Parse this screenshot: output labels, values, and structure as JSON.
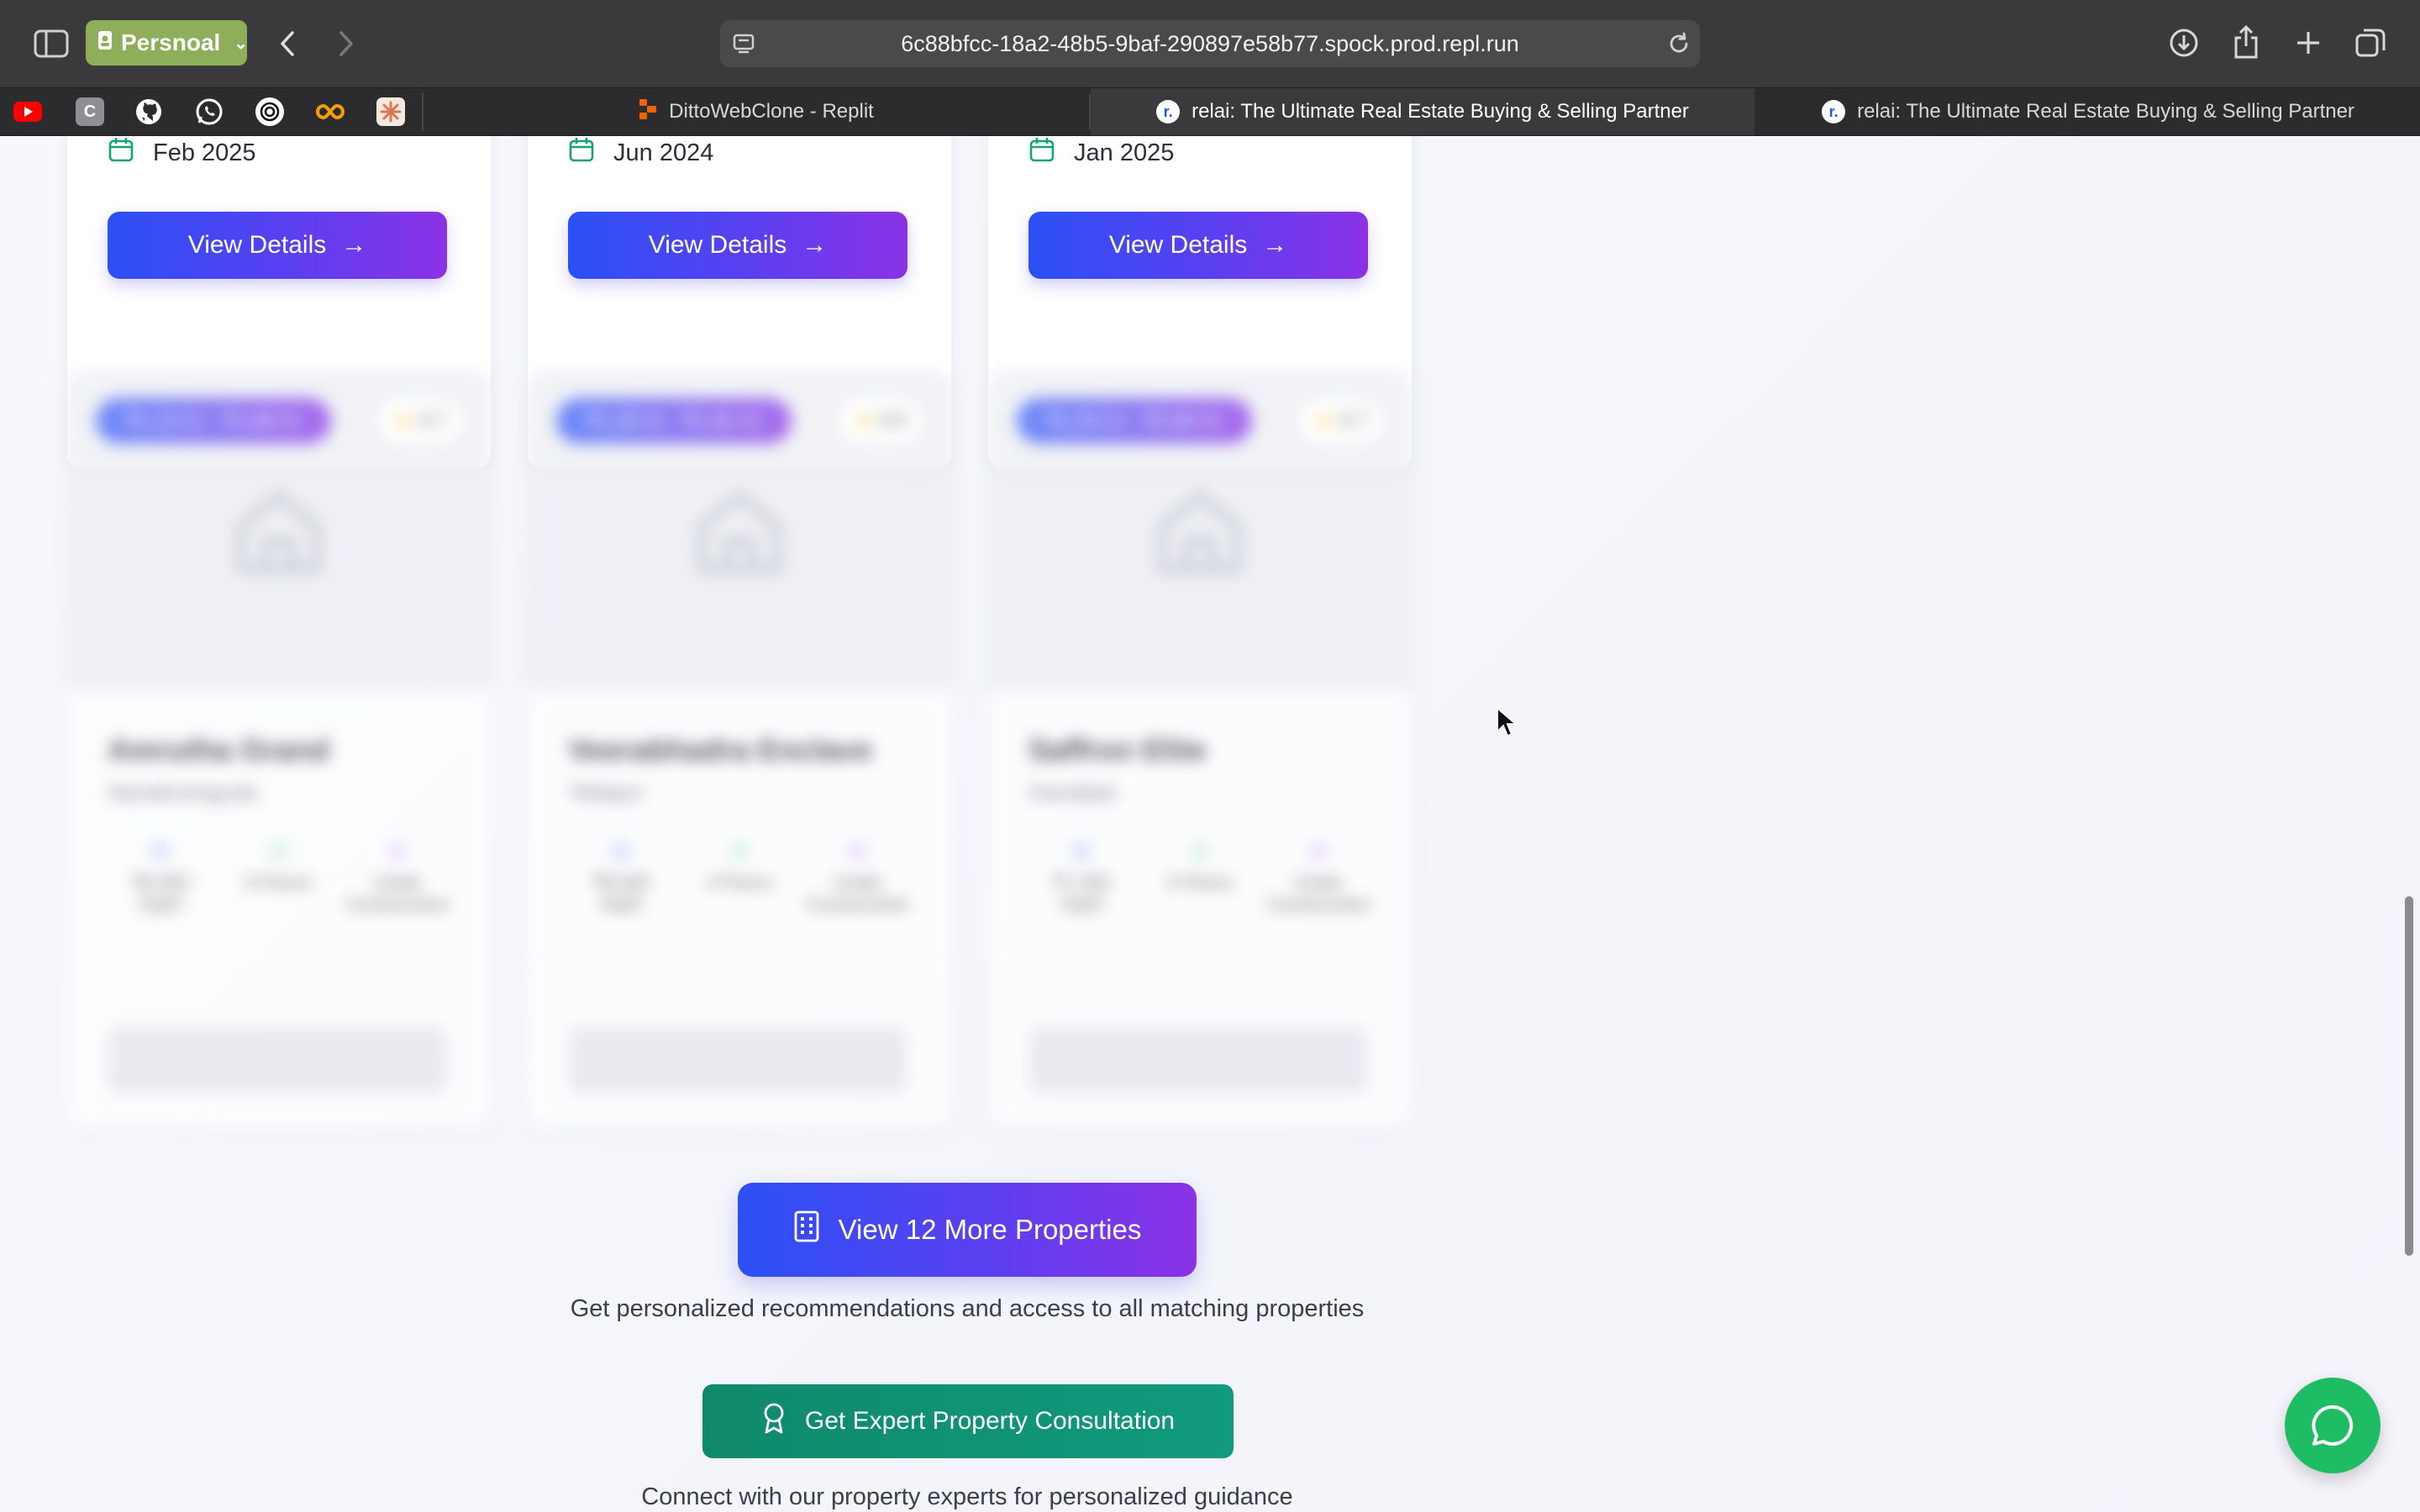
{
  "browser": {
    "profile_label": "Persnoal",
    "url": "6c88bfcc-18a2-48b5-9baf-290897e58b77.spock.prod.repl.run",
    "bookmarks": [
      "youtube-icon",
      "c-app-icon",
      "github-icon",
      "whatsapp-icon",
      "openai-icon",
      "infinity-icon",
      "claude-icon"
    ],
    "bookmark_c_label": "C",
    "tabs": [
      {
        "title": "DittoWebClone - Replit"
      },
      {
        "title": "relai: The Ultimate Real Estate Buying & Selling Partner"
      },
      {
        "title": "relai: The Ultimate Real Estate Buying & Selling Partner"
      }
    ],
    "relai_favicon_letter": "r."
  },
  "properties_top": [
    {
      "date": "Feb 2025",
      "button_label": "View Details",
      "arrow": "→"
    },
    {
      "date": "Jun 2024",
      "button_label": "View Details",
      "arrow": "→"
    },
    {
      "date": "Jan 2025",
      "button_label": "View Details",
      "arrow": "→"
    }
  ],
  "properties_locked": [
    {
      "price": "₹1.13 Cr - ₹1.69 Cr",
      "rating": "4.7",
      "name": "Amrutha Grand",
      "location": "Nanakramguda",
      "stats": [
        "₹8,450 /SqFt",
        "6 Floors",
        "Under Construction"
      ]
    },
    {
      "price": "₹1.26 Cr - ₹1.81 Cr",
      "rating": "4.5",
      "name": "Veerabhadra Enclave",
      "location": "Tellapur",
      "stats": [
        "₹8,000 /SqFt",
        "4 Floors",
        "Under Construction"
      ]
    },
    {
      "price": "₹1.25 Cr - ₹2.60 Cr",
      "rating": "4.7",
      "name": "Saffron Elite",
      "location": "Gandipet",
      "stats": [
        "₹7,400 /SqFt",
        "5 Floors",
        "Under Construction"
      ]
    }
  ],
  "cta": {
    "more_label": "View 12 More Properties",
    "more_sub": "Get personalized recommendations and access to all matching properties",
    "consult_label": "Get Expert Property Consultation",
    "consult_sub": "Connect with our property experts for personalized guidance"
  },
  "colors": {
    "primary_gradient_start": "#2b50f5",
    "primary_gradient_end": "#8b32e6",
    "consult_green": "#0f8a6a",
    "chat_green": "#1fbd63",
    "calendar_green": "#16a37a"
  }
}
